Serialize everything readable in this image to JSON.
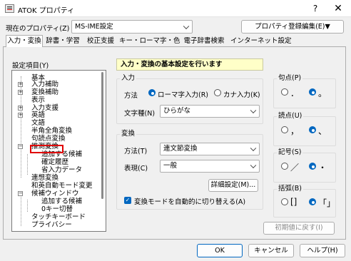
{
  "window": {
    "title": "ATOK プロパティ",
    "help_glyph": "?",
    "close_glyph": "✕"
  },
  "property": {
    "label": "現在のプロパティ(Z)",
    "value": "MS-IME設定",
    "edit_button": "プロパティ登録編集(E)▼"
  },
  "tabs": [
    "入力・変換",
    "辞書・学習",
    "校正支援",
    "キー・ローマ字・色",
    "電子辞書検索",
    "インターネット設定"
  ],
  "tree": {
    "label": "設定項目(Y)",
    "items": [
      "基本",
      "入力補助",
      "変換補助",
      "表示",
      "入力支援",
      "英語",
      "文語",
      "半角全角変換",
      "句読点変換",
      "推測変換",
      "追加する候補",
      "確定履歴",
      "省入力データ",
      "連想変換",
      "和英自動モード変更",
      "候補ウィンドウ",
      "追加する候補",
      "0キー切替",
      "タッチキーボード",
      "プライバシー"
    ],
    "expander_glyph": "+",
    "collapse_glyph": "−"
  },
  "banner": "入力・変換の基本設定を行います",
  "input_group": {
    "title": "入力",
    "method_label": "方法",
    "method_options": [
      "ローマ字入力(R)",
      "カナ入力(K)"
    ],
    "method_selected": 0,
    "char_label": "文字種(N)",
    "char_value": "ひらがな"
  },
  "conv_group": {
    "title": "変換",
    "method_label": "方法(T)",
    "method_value": "連文節変換",
    "expr_label": "表現(C)",
    "expr_value": "一般",
    "detail_button": "詳細設定(M)...",
    "auto_switch_label": "変換モードを自動的に切り替える(A)",
    "auto_switch_checked": true
  },
  "punct": {
    "title": "句点(P)",
    "options": [
      "．",
      "。"
    ],
    "selected": 1
  },
  "comma": {
    "title": "読点(U)",
    "options": [
      "，",
      "、"
    ],
    "selected": 1
  },
  "symbol": {
    "title": "記号(S)",
    "options": [
      "／",
      "・"
    ],
    "selected": 1
  },
  "bracket": {
    "title": "括弧(B)",
    "options": [
      "[]",
      "「」"
    ],
    "selected": 1
  },
  "reset_button": "初期値に戻す(I)",
  "footer": {
    "ok": "OK",
    "cancel": "キャンセル",
    "help": "ヘルプ(H)"
  },
  "colors": {
    "accent": "#0067c0",
    "highlight_box": "#e00000",
    "banner_bg": "#ffffc8"
  }
}
